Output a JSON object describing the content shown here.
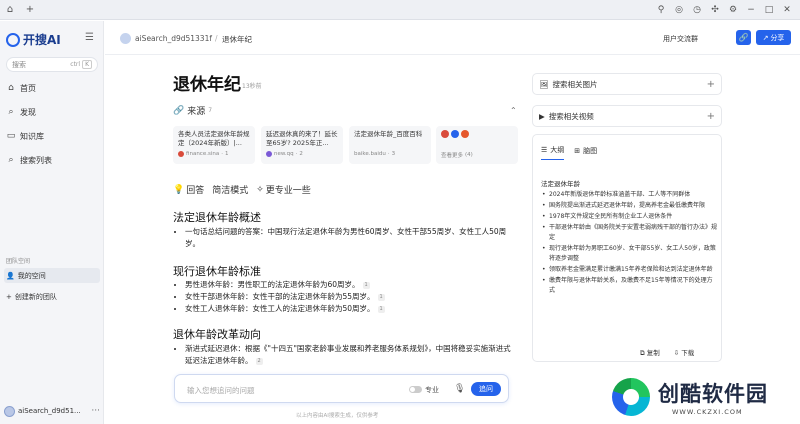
{
  "sidebar": {
    "logo_text": "开搜AI",
    "search_placeholder": "搜索",
    "search_kbd": "ctrl",
    "search_key": "K",
    "nav": [
      {
        "label": "首页",
        "icon": "home-icon"
      },
      {
        "label": "发现",
        "icon": "discover-icon"
      },
      {
        "label": "知识库",
        "icon": "library-icon"
      },
      {
        "label": "搜索列表",
        "icon": "list-icon"
      }
    ],
    "team_section": "团队空间",
    "my_space": "我的空间",
    "create_team": "创建新的团队",
    "user": "aiSearch_d9d51..."
  },
  "header": {
    "user": "aiSearch_d9d51331f",
    "separator": "/",
    "crumb": "退休年纪",
    "group_label": "用户交流群",
    "share_label": "分享"
  },
  "main": {
    "title": "退休年纪",
    "time": "13秒前",
    "sources_label": "来源",
    "sources_count": "7",
    "source_cards": [
      {
        "title": "各类人员法定退休年龄规定（2024年新版）|...",
        "site": "finance.sina",
        "index": "1",
        "color": "#d94b3b"
      },
      {
        "title": "延迟退休真的来了！延长至65岁? 2025年正...",
        "site": "new.qq",
        "index": "2",
        "color": "#7b5ad6"
      },
      {
        "title": "法定退休年龄_百度百科",
        "site": "baike.baidu",
        "index": "3",
        "color": "#8a94a6"
      }
    ],
    "more_label": "查看更多",
    "more_count": "(4)",
    "tabs": [
      {
        "label": "回答",
        "icon": "bulb-icon"
      },
      {
        "label": "简洁模式",
        "icon": ""
      },
      {
        "label": "更专业一些",
        "icon": "sparkle-icon"
      }
    ],
    "sections": [
      {
        "heading": "法定退休年龄概述",
        "items": [
          {
            "text": "一句话总结问题的答案：中国现行法定退休年龄为男性60周岁、女性干部55周岁、女性工人50周岁。",
            "cite": ""
          }
        ]
      },
      {
        "heading": "现行退休年龄标准",
        "items": [
          {
            "text": "男性退休年龄：男性职工的法定退休年龄为60周岁。",
            "cite": "1"
          },
          {
            "text": "女性干部退休年龄：女性干部的法定退休年龄为55周岁。",
            "cite": "1"
          },
          {
            "text": "女性工人退休年龄：女性工人的法定退休年龄为50周岁。",
            "cite": "1"
          }
        ]
      },
      {
        "heading": "退休年龄改革动向",
        "items": [
          {
            "text": "渐进式延迟退休：根据《\"十四五\"国家老龄事业发展和养老服务体系规划》，中国将稳妥实施渐进式延迟法定退休年龄。",
            "cite": "2"
          }
        ]
      }
    ],
    "input_placeholder": "输入您想追问的问题",
    "pro_label": "专业",
    "send_label": "追问",
    "footnote": "以上内容由AI搜索生成，仅供参考"
  },
  "right": {
    "images_label": "搜索相关图片",
    "videos_label": "搜索相关视频",
    "tab_outline": "大纲",
    "tab_mindmap": "脑图",
    "outline_head": "法定退休年龄",
    "outline_items": [
      "2024年新版退休年龄标准涵盖干部、工人等不同群体",
      "国务院提出渐进式延迟退休年龄，提高养老金最低缴费年限",
      "1978年文件规定全民所有制企业工人退休条件",
      "干部退休年龄由《国务院关于安置老弱病残干部的暂行办法》规定",
      "现行退休年龄为男职工60岁、女干部55岁、女工人50岁，政策将逐步调整",
      "领取养老金需满足累计缴满15年养老保险和达到法定退休年龄",
      "缴费年限与退休年龄关系，及缴费不足15年等情况下的处理方式"
    ],
    "copy_label": "复制",
    "download_label": "下载"
  },
  "watermark": {
    "text": "创酷软件园",
    "url": "WWW.CKZXI.COM"
  },
  "colors": {
    "accent": "#2563eb"
  }
}
